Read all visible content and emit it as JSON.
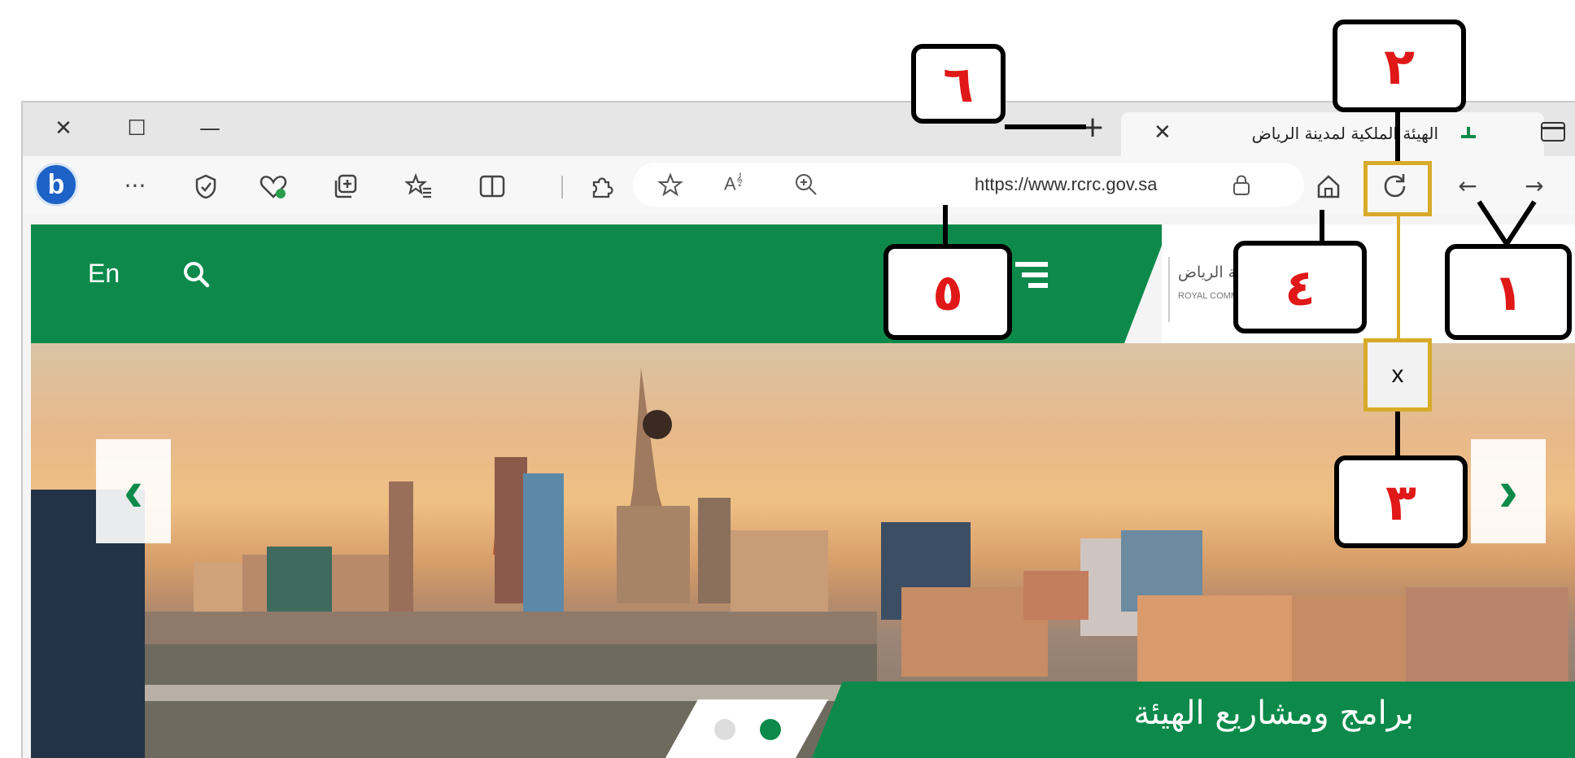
{
  "browser": {
    "window_controls": {
      "close": "✕",
      "maximize": "☐",
      "minimize": "—"
    },
    "tab": {
      "title": "الهيئة الملكية لمدينة الرياض",
      "close": "✕"
    },
    "new_tab": "+",
    "toolbar": {
      "url": "https://www.rcrc.gov.sa",
      "back": "←",
      "forward": "→",
      "more": "···"
    }
  },
  "site": {
    "lang_toggle": "En",
    "logo_ar": "الهيئة الملكية لمدينة الرياض",
    "logo_en": "ROYAL COMMISSION FOR RIYADH CITY",
    "slider": {
      "prev": "‹",
      "next": "›",
      "active_dot": 1
    },
    "banner_text": "برامج ومشاريع الهيئة"
  },
  "annotations": {
    "labels": [
      "١",
      "٢",
      "٣",
      "٤",
      "٥",
      "٦"
    ],
    "stop_x": "x"
  },
  "colors": {
    "brand_green": "#0d8a4b",
    "callout_red": "#e01818",
    "highlight": "#d8aa2a"
  }
}
